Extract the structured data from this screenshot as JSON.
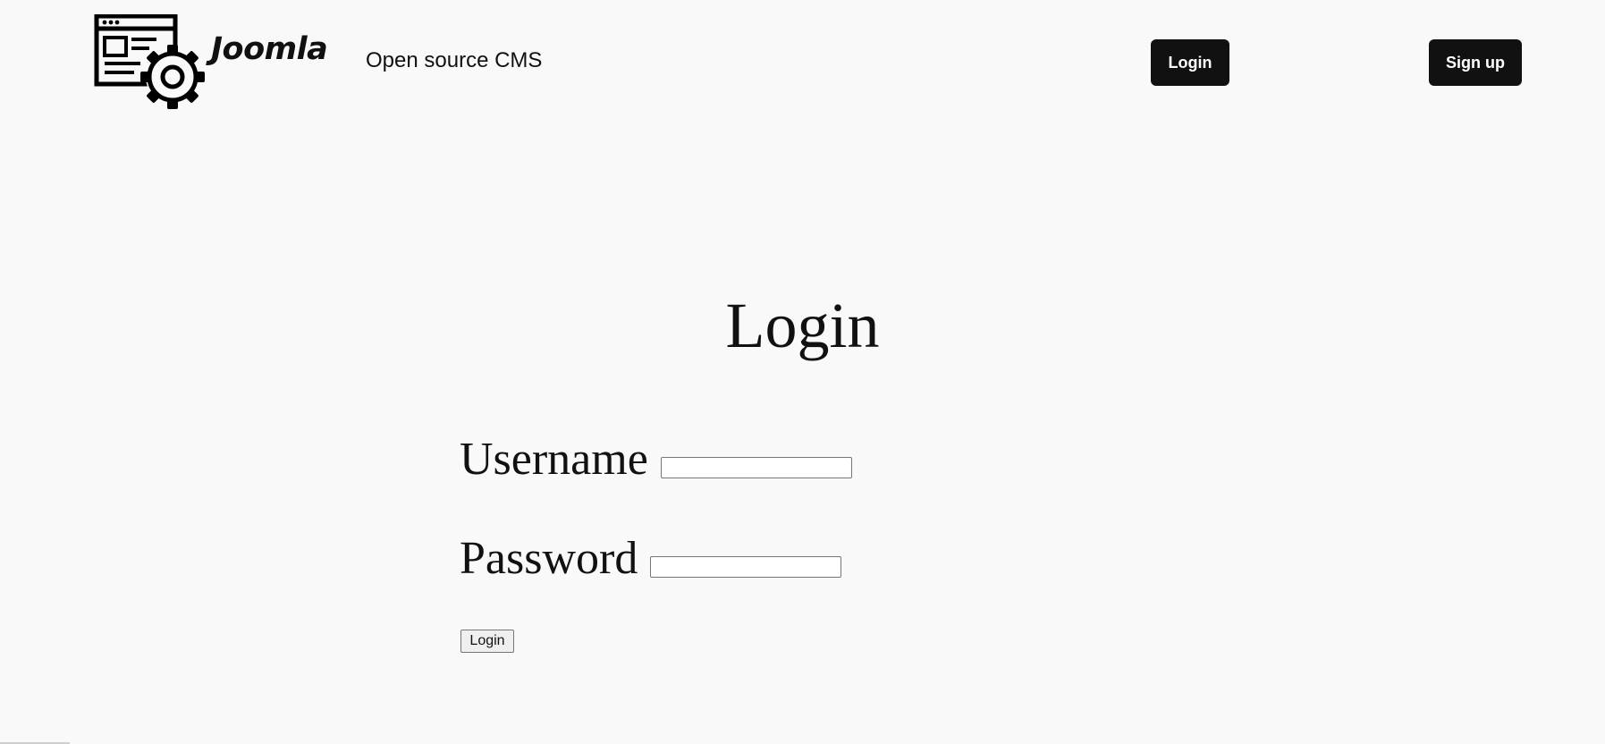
{
  "header": {
    "brand": "Joomla",
    "tagline": "Open source CMS",
    "logo_icon": "browser-gear-icon",
    "login_label": "Login",
    "signup_label": "Sign up"
  },
  "main": {
    "title": "Login",
    "username_label": "Username",
    "username_value": "",
    "password_label": "Password",
    "password_value": "",
    "submit_label": "Login"
  },
  "colors": {
    "background": "#f9f9f9",
    "button_dark": "#111111",
    "button_text": "#ffffff"
  }
}
